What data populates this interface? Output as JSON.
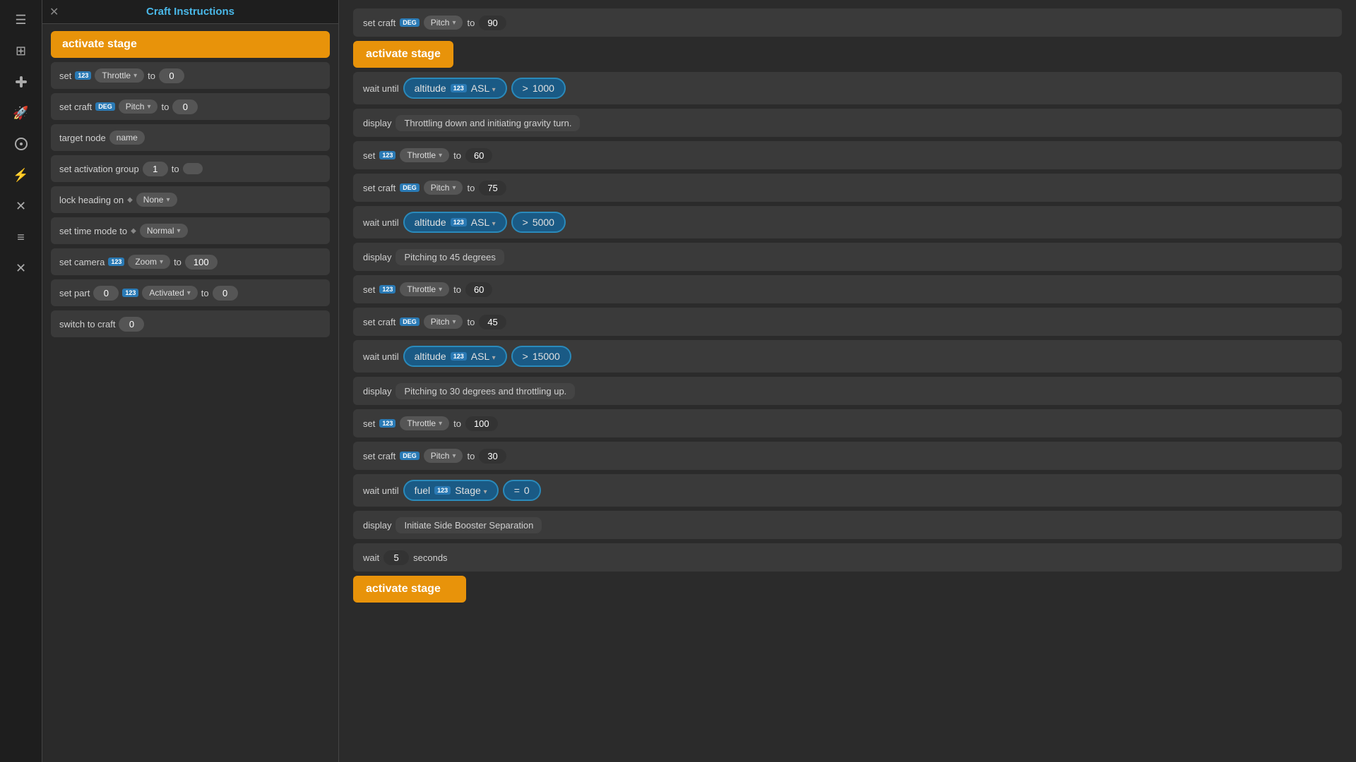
{
  "sidebar": {
    "icons": [
      "☰",
      "⊞",
      "✚",
      "🚀",
      "⊙",
      "⚡",
      "✕",
      "≡",
      "✕"
    ]
  },
  "panel": {
    "title": "Craft Instructions",
    "close_icon": "✕",
    "blocks": [
      {
        "type": "orange",
        "label": "activate stage"
      },
      {
        "type": "set_throttle",
        "label": "set",
        "badge": "123",
        "param": "Throttle",
        "to": "to",
        "value": "0"
      },
      {
        "type": "set_craft_pitch",
        "label": "set craft",
        "badge": "DEG",
        "param": "Pitch",
        "to": "to",
        "value": "0"
      },
      {
        "type": "target_node",
        "label": "target node",
        "param": "name"
      },
      {
        "type": "set_activation",
        "label": "set activation group",
        "value": "1",
        "to": "to"
      },
      {
        "type": "lock_heading",
        "label": "lock heading on",
        "diamond": "◆",
        "param": "None"
      },
      {
        "type": "set_time_mode",
        "label": "set time mode to",
        "diamond": "◆",
        "param": "Normal"
      },
      {
        "type": "set_camera",
        "label": "set camera",
        "badge": "123",
        "param": "Zoom",
        "to": "to",
        "value": "100"
      },
      {
        "type": "set_part",
        "label": "set part",
        "value1": "0",
        "badge": "123",
        "param": "Activated",
        "to": "to",
        "value2": "0"
      },
      {
        "type": "switch_to_craft",
        "label": "switch to craft",
        "value": "0"
      }
    ]
  },
  "main": {
    "blocks": [
      {
        "type": "set_craft_pitch",
        "label": "set craft",
        "badge": "DEG",
        "param": "Pitch",
        "to": "to",
        "value": "90"
      },
      {
        "type": "orange",
        "label": "activate stage"
      },
      {
        "type": "wait_until",
        "label": "wait until",
        "condition_label": "altitude",
        "badge": "123",
        "condition_param": "ASL",
        "operator": ">",
        "condition_value": "1000"
      },
      {
        "type": "display",
        "label": "display",
        "text": "Throttling down and initiating gravity turn."
      },
      {
        "type": "set_throttle",
        "label": "set",
        "badge": "123",
        "param": "Throttle",
        "to": "to",
        "value": "60"
      },
      {
        "type": "set_craft_pitch",
        "label": "set craft",
        "badge": "DEG",
        "param": "Pitch",
        "to": "to",
        "value": "75"
      },
      {
        "type": "wait_until",
        "label": "wait until",
        "condition_label": "altitude",
        "badge": "123",
        "condition_param": "ASL",
        "operator": ">",
        "condition_value": "5000"
      },
      {
        "type": "display",
        "label": "display",
        "text": "Pitching to 45 degrees"
      },
      {
        "type": "set_throttle",
        "label": "set",
        "badge": "123",
        "param": "Throttle",
        "to": "to",
        "value": "60"
      },
      {
        "type": "set_craft_pitch",
        "label": "set craft",
        "badge": "DEG",
        "param": "Pitch",
        "to": "to",
        "value": "45"
      },
      {
        "type": "wait_until",
        "label": "wait until",
        "condition_label": "altitude",
        "badge": "123",
        "condition_param": "ASL",
        "operator": ">",
        "condition_value": "15000"
      },
      {
        "type": "display",
        "label": "display",
        "text": "Pitching to 30 degrees and throttling up."
      },
      {
        "type": "set_throttle",
        "label": "set",
        "badge": "123",
        "param": "Throttle",
        "to": "to",
        "value": "100"
      },
      {
        "type": "set_craft_pitch",
        "label": "set craft",
        "badge": "DEG",
        "param": "Pitch",
        "to": "to",
        "value": "30"
      },
      {
        "type": "wait_until_fuel",
        "label": "wait until",
        "condition_label": "fuel",
        "badge": "123",
        "condition_param": "Stage",
        "operator": "=",
        "condition_value": "0"
      },
      {
        "type": "display",
        "label": "display",
        "text": "Initiate Side Booster Separation"
      },
      {
        "type": "wait",
        "label": "wait",
        "value": "5",
        "unit": "seconds"
      },
      {
        "type": "orange_partial",
        "label": "activate stage"
      }
    ]
  }
}
